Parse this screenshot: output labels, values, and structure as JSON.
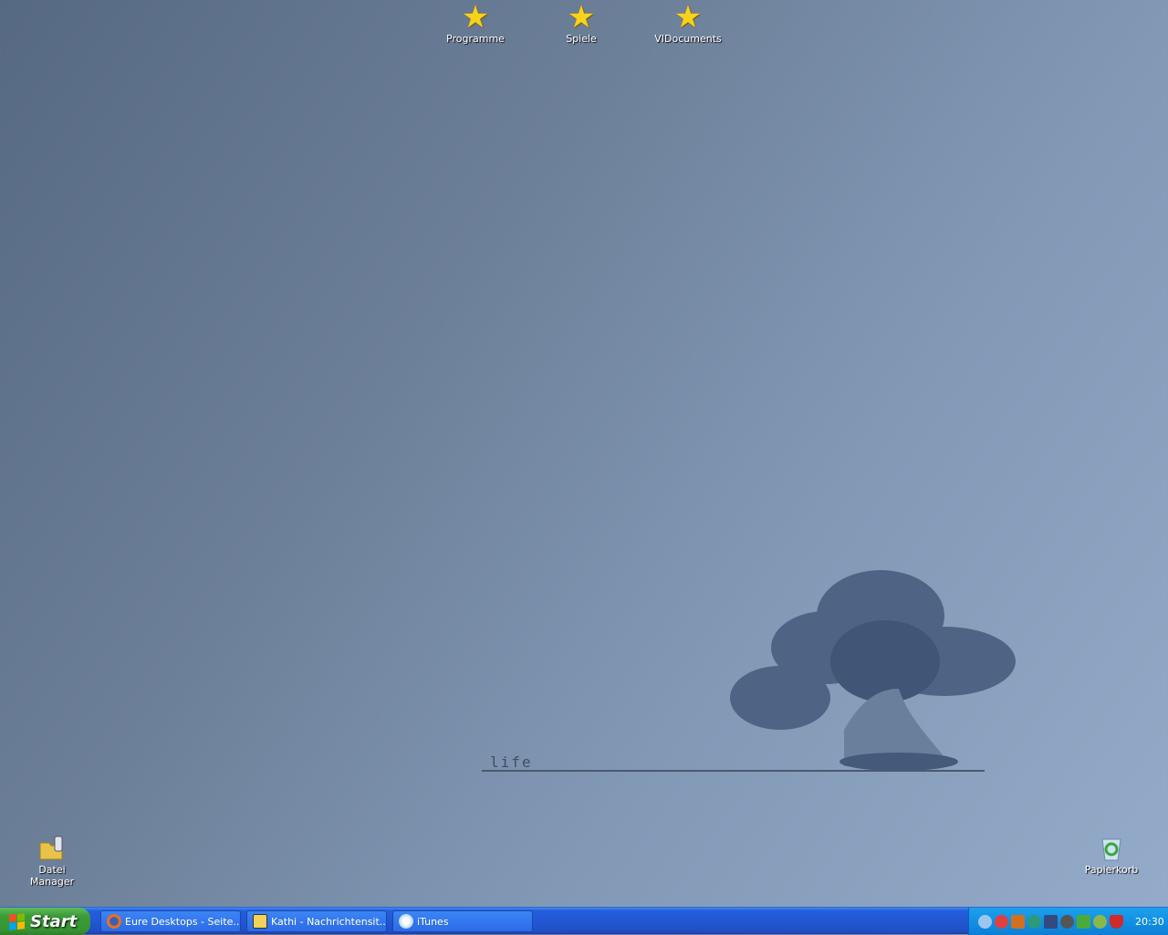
{
  "desktop_icons": [
    {
      "label": "Programme",
      "icon": "star-icon"
    },
    {
      "label": "Spiele",
      "icon": "star-icon"
    },
    {
      "label": "VIDocuments",
      "icon": "star-icon"
    },
    {
      "label": "Datei Manager",
      "icon": "folder-phone-icon"
    },
    {
      "label": "Papierkorb",
      "icon": "recycle-bin-icon"
    }
  ],
  "wallpaper": {
    "text": "life"
  },
  "taskbar": {
    "start_label": "Start",
    "tasks": [
      {
        "label": "Eure Desktops - Seite...",
        "icon": "firefox-icon"
      },
      {
        "label": "Kathi - Nachrichtensit...",
        "icon": "messenger-icon"
      },
      {
        "label": "iTunes",
        "icon": "itunes-icon"
      }
    ],
    "tray_icons": [
      "itunes-icon",
      "stop-icon",
      "volume-icon",
      "logitech-icon",
      "network-icon",
      "speaker-icon",
      "safely-remove-icon",
      "headset-icon",
      "security-shield-icon"
    ],
    "clock": "20:30"
  }
}
